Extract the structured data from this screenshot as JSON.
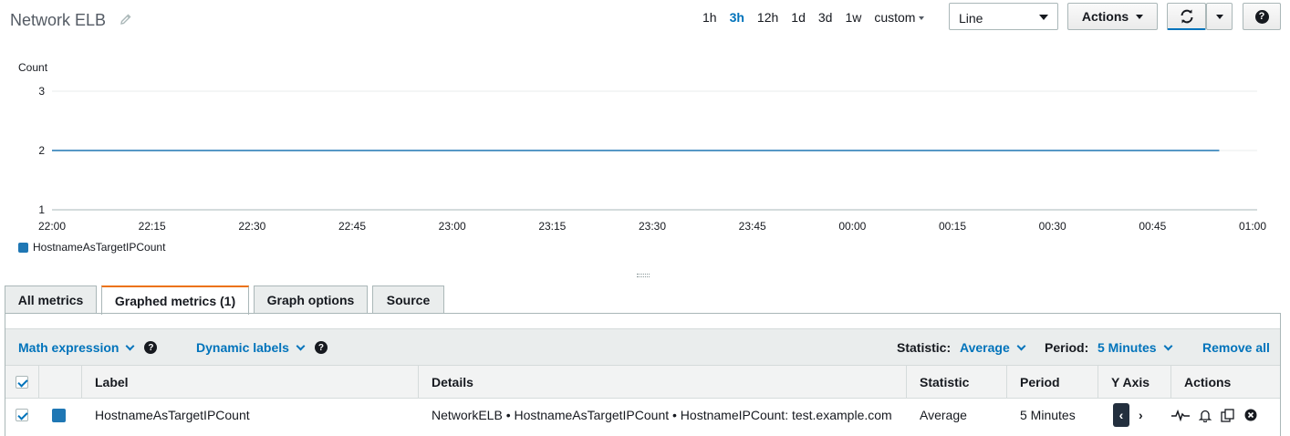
{
  "header": {
    "title": "Network ELB",
    "time_ranges": [
      "1h",
      "3h",
      "12h",
      "1d",
      "3d",
      "1w"
    ],
    "active_range": "3h",
    "custom_label": "custom",
    "chart_type_select": "Line",
    "actions_label": "Actions",
    "help_label": "?"
  },
  "chart_data": {
    "type": "line",
    "ylabel": "Count",
    "yticks": [
      1,
      2,
      3
    ],
    "ylim": [
      1,
      3
    ],
    "xticks": [
      "22:00",
      "22:15",
      "22:30",
      "22:45",
      "23:00",
      "23:15",
      "23:30",
      "23:45",
      "00:00",
      "00:15",
      "00:30",
      "00:45",
      "01:00"
    ],
    "series": [
      {
        "name": "HostnameAsTargetIPCount",
        "color": "#1f77b4",
        "x": [
          "22:00",
          "00:55"
        ],
        "values": [
          2,
          2
        ]
      }
    ],
    "grid": true
  },
  "legend": {
    "label": "HostnameAsTargetIPCount",
    "color": "#1f77b4"
  },
  "tabs": [
    {
      "label": "All metrics",
      "active": false
    },
    {
      "label": "Graphed metrics (1)",
      "active": true
    },
    {
      "label": "Graph options",
      "active": false
    },
    {
      "label": "Source",
      "active": false
    }
  ],
  "toolbar": {
    "math_expression": "Math expression",
    "dynamic_labels": "Dynamic labels",
    "statistic_label": "Statistic:",
    "statistic_value": "Average",
    "period_label": "Period:",
    "period_value": "5 Minutes",
    "remove_all": "Remove all"
  },
  "table": {
    "headers": {
      "label": "Label",
      "details": "Details",
      "statistic": "Statistic",
      "period": "Period",
      "yaxis": "Y Axis",
      "actions": "Actions"
    },
    "rows": [
      {
        "checked": true,
        "color": "#1f77b4",
        "label": "HostnameAsTargetIPCount",
        "details": "NetworkELB • HostnameAsTargetIPCount • HostnameIPCount: test.example.com",
        "statistic": "Average",
        "period": "5 Minutes",
        "yaxis_left": "‹",
        "yaxis_right": "›"
      }
    ]
  },
  "colors": {
    "accent": "#0073bb",
    "tab_active_border": "#ec7211",
    "series": "#1f77b4"
  }
}
